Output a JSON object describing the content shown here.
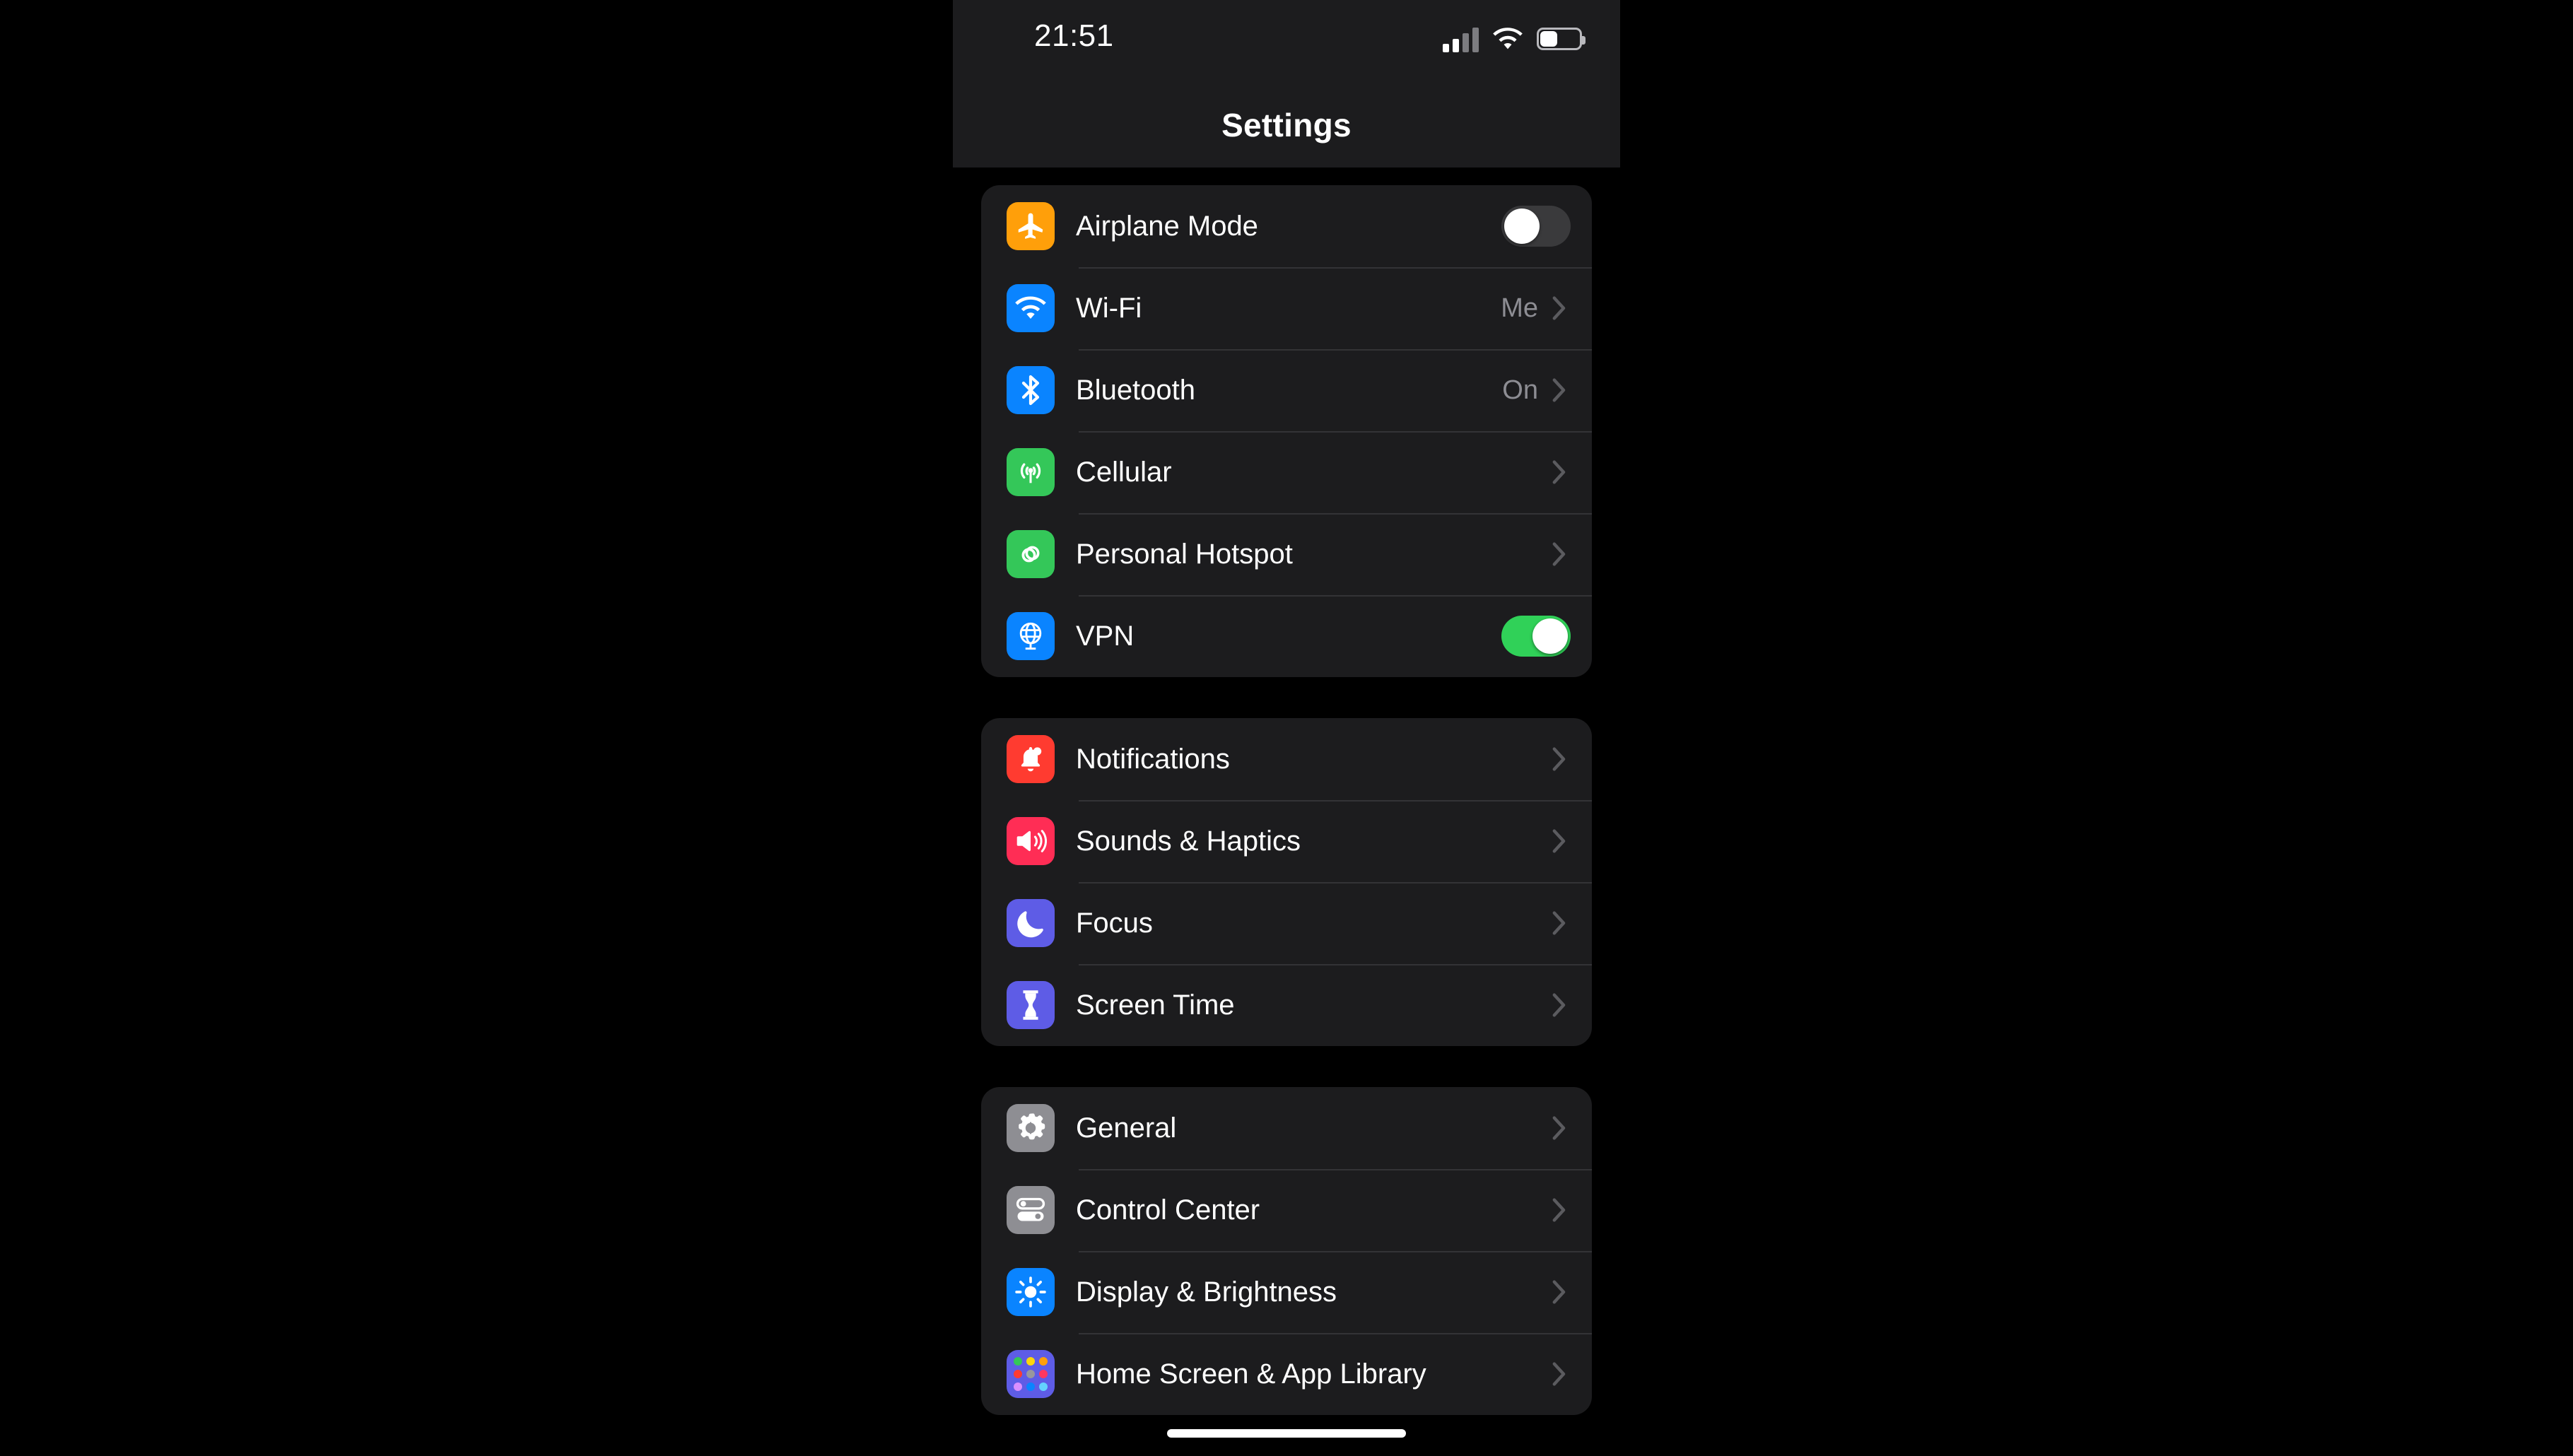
{
  "device": {
    "status_bar": {
      "time": "21:51",
      "signal_icon": "cellular-signal-icon",
      "wifi_icon": "wifi-icon",
      "battery_icon": "battery-icon",
      "battery_level_percent": 42
    },
    "home_indicator": "home-indicator"
  },
  "header": {
    "title": "Settings"
  },
  "colors": {
    "card_bg": "#1c1c1e",
    "screen_bg": "#000000",
    "separator": "#333336",
    "secondary_text": "#8d8d93",
    "toggle_on": "#30d158",
    "toggle_off": "#3a3a3c",
    "orange": "#ff9f0a",
    "blue": "#0a84ff",
    "green": "#34c759",
    "red": "#ff3b30",
    "pink": "#ff2d55",
    "indigo": "#5e5ce6",
    "gray": "#8e8e93"
  },
  "groups": [
    {
      "id": "connectivity",
      "rows": [
        {
          "label": "Airplane Mode",
          "icon": "airplane-icon",
          "icon_color": "#ff9f0a",
          "accessory": "toggle",
          "toggle_state": "off",
          "value": ""
        },
        {
          "label": "Wi-Fi",
          "icon": "wifi-icon",
          "icon_color": "#0a84ff",
          "accessory": "disclosure",
          "value": "Me"
        },
        {
          "label": "Bluetooth",
          "icon": "bluetooth-icon",
          "icon_color": "#0a84ff",
          "accessory": "disclosure",
          "value": "On"
        },
        {
          "label": "Cellular",
          "icon": "cellular-icon",
          "icon_color": "#34c759",
          "accessory": "disclosure",
          "value": ""
        },
        {
          "label": "Personal Hotspot",
          "icon": "hotspot-link-icon",
          "icon_color": "#34c759",
          "accessory": "disclosure",
          "value": ""
        },
        {
          "label": "VPN",
          "icon": "vpn-globe-icon",
          "icon_color": "#0a84ff",
          "accessory": "toggle",
          "toggle_state": "on",
          "value": ""
        }
      ]
    },
    {
      "id": "alerts",
      "rows": [
        {
          "label": "Notifications",
          "icon": "bell-icon",
          "icon_color": "#ff3b30",
          "accessory": "disclosure",
          "value": ""
        },
        {
          "label": "Sounds & Haptics",
          "icon": "speaker-icon",
          "icon_color": "#ff2d55",
          "accessory": "disclosure",
          "value": ""
        },
        {
          "label": "Focus",
          "icon": "moon-icon",
          "icon_color": "#5e5ce6",
          "accessory": "disclosure",
          "value": ""
        },
        {
          "label": "Screen Time",
          "icon": "hourglass-icon",
          "icon_color": "#5e5ce6",
          "accessory": "disclosure",
          "value": ""
        }
      ]
    },
    {
      "id": "system",
      "rows": [
        {
          "label": "General",
          "icon": "gear-icon",
          "icon_color": "#8e8e93",
          "accessory": "disclosure",
          "value": ""
        },
        {
          "label": "Control Center",
          "icon": "control-center-icon",
          "icon_color": "#8e8e93",
          "accessory": "disclosure",
          "value": ""
        },
        {
          "label": "Display & Brightness",
          "icon": "brightness-icon",
          "icon_color": "#0a84ff",
          "accessory": "disclosure",
          "value": ""
        },
        {
          "label": "Home Screen & App Library",
          "icon": "app-grid-icon",
          "icon_color": "#5e5ce6",
          "accessory": "disclosure",
          "value": ""
        }
      ]
    }
  ]
}
